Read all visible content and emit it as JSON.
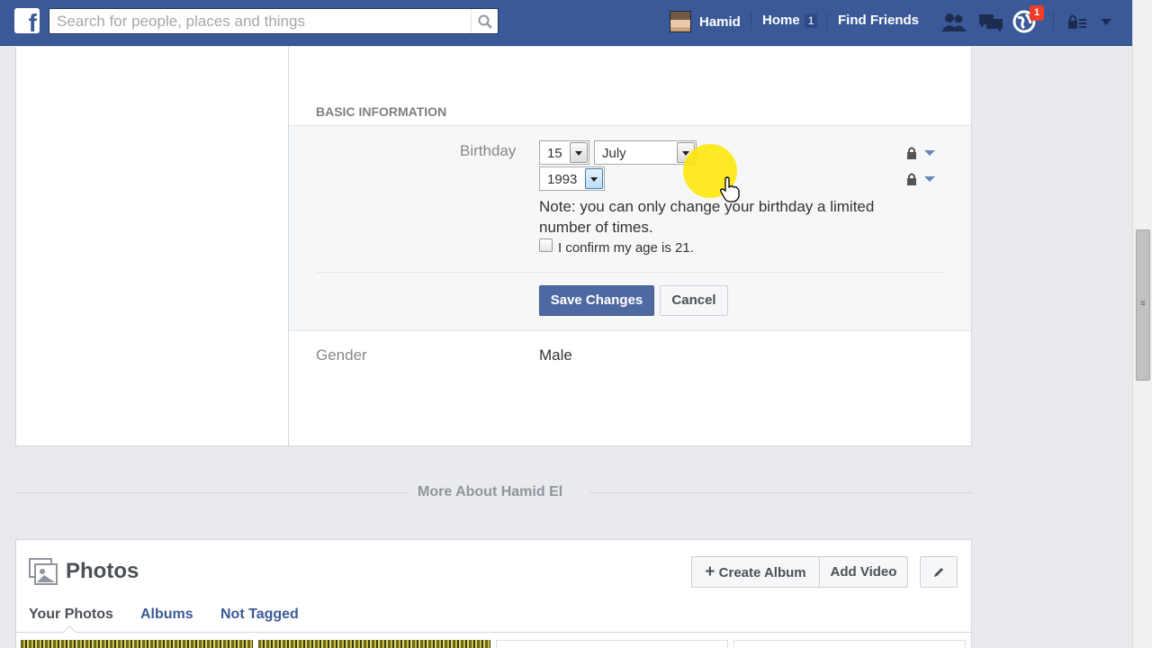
{
  "topbar": {
    "logo": "f",
    "search_placeholder": "Search for people, places and things",
    "profile_name": "Hamid",
    "home_label": "Home",
    "home_count": "1",
    "find_friends_label": "Find Friends",
    "notification_count": "1",
    "icons": [
      "friend-requests-icon",
      "messages-icon",
      "notifications-globe-icon",
      "privacy-shortcuts-icon",
      "account-menu-icon"
    ],
    "colors": {
      "bar": "#3b5998",
      "badge": "#f03d25"
    }
  },
  "basic_info": {
    "section_title": "BASIC INFORMATION",
    "birthday": {
      "label": "Birthday",
      "day": "15",
      "month": "July",
      "year": "1993",
      "note": "Note: you can only change your birthday a limited number of times.",
      "confirm_label": "I confirm my age is 21."
    },
    "save_label": "Save Changes",
    "cancel_label": "Cancel",
    "gender": {
      "label": "Gender",
      "value": "Male"
    }
  },
  "more_about": "More About Hamid El",
  "photos": {
    "title": "Photos",
    "create_album_label": "Create Album",
    "add_video_label": "Add Video",
    "tabs": [
      "Your Photos",
      "Albums",
      "Not Tagged"
    ]
  }
}
